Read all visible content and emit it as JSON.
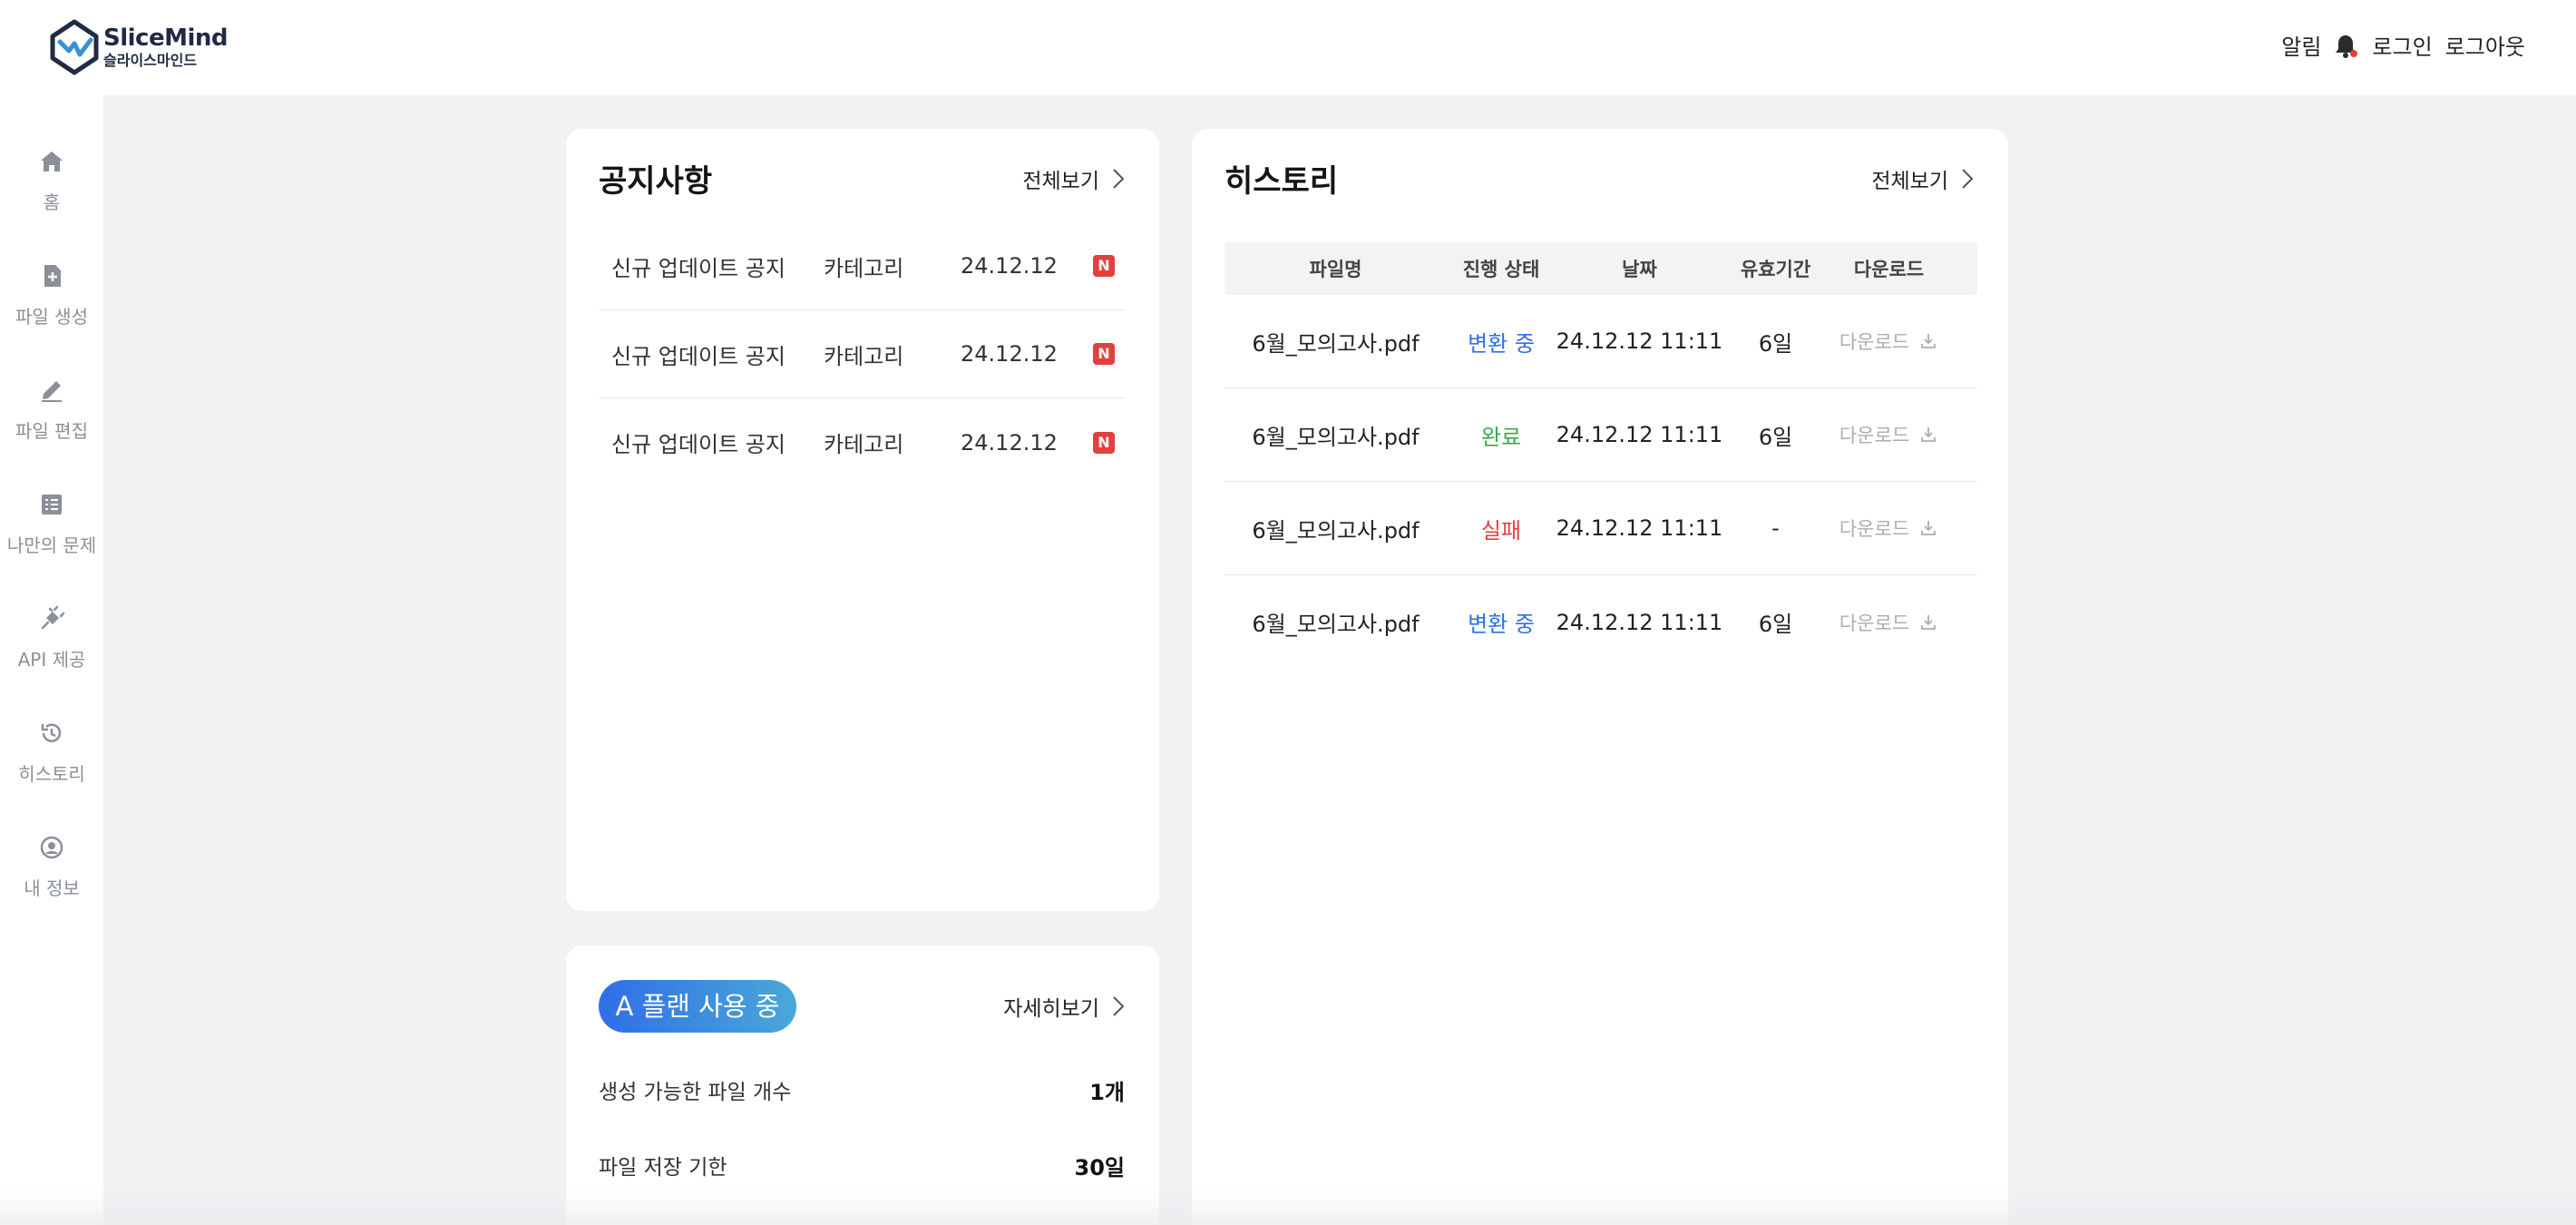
{
  "header": {
    "brand_en": "SliceMind",
    "brand_ko": "슬라이스마인드",
    "notifications_label": "알림",
    "login_label": "로그인",
    "logout_label": "로그아웃"
  },
  "sidebar": {
    "items": [
      {
        "label": "홈",
        "icon": "home-icon"
      },
      {
        "label": "파일 생성",
        "icon": "file-add-icon"
      },
      {
        "label": "파일 편집",
        "icon": "pencil-icon"
      },
      {
        "label": "나만의 문제",
        "icon": "list-icon"
      },
      {
        "label": "API 제공",
        "icon": "plug-icon"
      },
      {
        "label": "히스토리",
        "icon": "history-icon"
      },
      {
        "label": "내 정보",
        "icon": "user-icon"
      }
    ]
  },
  "notices": {
    "title": "공지사항",
    "more_label": "전체보기",
    "items": [
      {
        "title": "신규 업데이트 공지",
        "category": "카테고리",
        "date": "24.12.12",
        "badge": "N"
      },
      {
        "title": "신규 업데이트 공지",
        "category": "카테고리",
        "date": "24.12.12",
        "badge": "N"
      },
      {
        "title": "신규 업데이트 공지",
        "category": "카테고리",
        "date": "24.12.12",
        "badge": "N"
      }
    ]
  },
  "plan": {
    "badge": "A 플랜 사용 중",
    "more_label": "자세히보기",
    "rows": [
      {
        "label": "생성 가능한 파일 개수",
        "value": "1개"
      },
      {
        "label": "파일 저장 기한",
        "value": "30일"
      }
    ]
  },
  "history": {
    "title": "히스토리",
    "more_label": "전체보기",
    "columns": [
      "파일명",
      "진행 상태",
      "날짜",
      "유효기간",
      "다운로드"
    ],
    "rows": [
      {
        "filename": "6월_모의고사.pdf",
        "status": "변환 중",
        "status_color": "#2f6ee8",
        "date": "24.12.12 11:11",
        "validity": "6일",
        "download": "다운로드"
      },
      {
        "filename": "6월_모의고사.pdf",
        "status": "완료",
        "status_color": "#35a94a",
        "date": "24.12.12 11:11",
        "validity": "6일",
        "download": "다운로드"
      },
      {
        "filename": "6월_모의고사.pdf",
        "status": "실패",
        "status_color": "#e0413e",
        "date": "24.12.12 11:11",
        "validity": "-",
        "download": "다운로드"
      },
      {
        "filename": "6월_모의고사.pdf",
        "status": "변환 중",
        "status_color": "#2f6ee8",
        "date": "24.12.12 11:11",
        "validity": "6일",
        "download": "다운로드"
      }
    ]
  },
  "colors": {
    "accent_blue": "#2f6ee8",
    "success_green": "#35a94a",
    "danger_red": "#e0413e",
    "background": "#f1f2f4"
  }
}
